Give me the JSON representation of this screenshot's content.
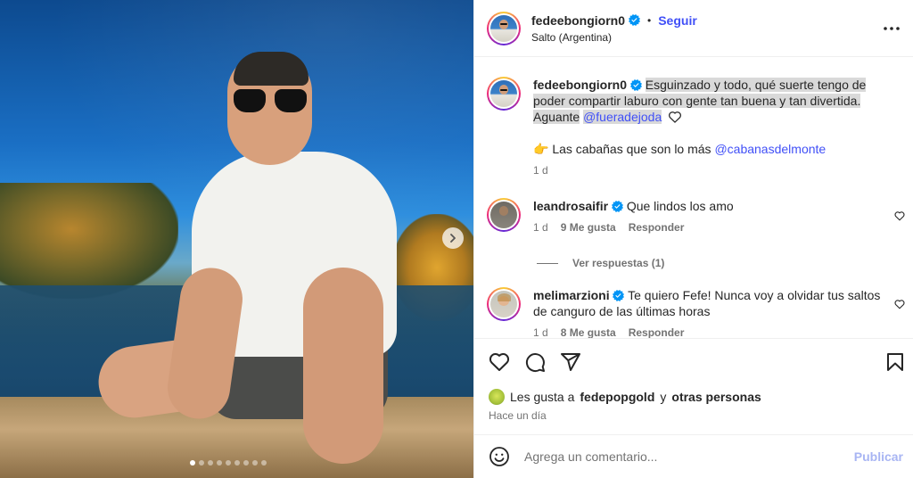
{
  "post": {
    "username": "fedeebongiorn0",
    "separator": "•",
    "follow_label": "Seguir",
    "location": "Salto (Argentina)",
    "more_icon": "more-horizontal-icon",
    "carousel": {
      "image_count": 9,
      "current_index": 1
    }
  },
  "caption": {
    "username": "fedeebongiorn0",
    "text_highlighted": "Esguinzado y todo, qué suerte tengo de poder compartir laburo con gente tan buena y tan divertida. Aguante",
    "mention": "@fueradejoda",
    "line2_emoji": "👉",
    "line2_text": "Las cabañas que son lo más",
    "line2_mention": "@cabanasdelmonte",
    "time": "1 d"
  },
  "comments": [
    {
      "username": "leandrosaifir",
      "text": "Que lindos los amo",
      "time": "1 d",
      "likes": "9 Me gusta",
      "reply_label": "Responder",
      "view_replies": "Ver respuestas (1)"
    },
    {
      "username": "melimarzioni",
      "text": "Te quiero Fefe! Nunca voy a olvidar tus saltos de canguro de las últimas horas",
      "time": "1 d",
      "likes": "8 Me gusta",
      "reply_label": "Responder"
    }
  ],
  "likes_line": {
    "prefix": "Les gusta a",
    "user": "fedepopgold",
    "conjunction": "y",
    "others": "otras personas"
  },
  "posted_ago": "Hace un día",
  "composer": {
    "placeholder": "Agrega un comentario...",
    "publish_label": "Publicar"
  },
  "colors": {
    "link": "#4150f7",
    "muted": "#737373",
    "verified": "#0095f6",
    "publish_disabled": "#a8b5f3"
  }
}
